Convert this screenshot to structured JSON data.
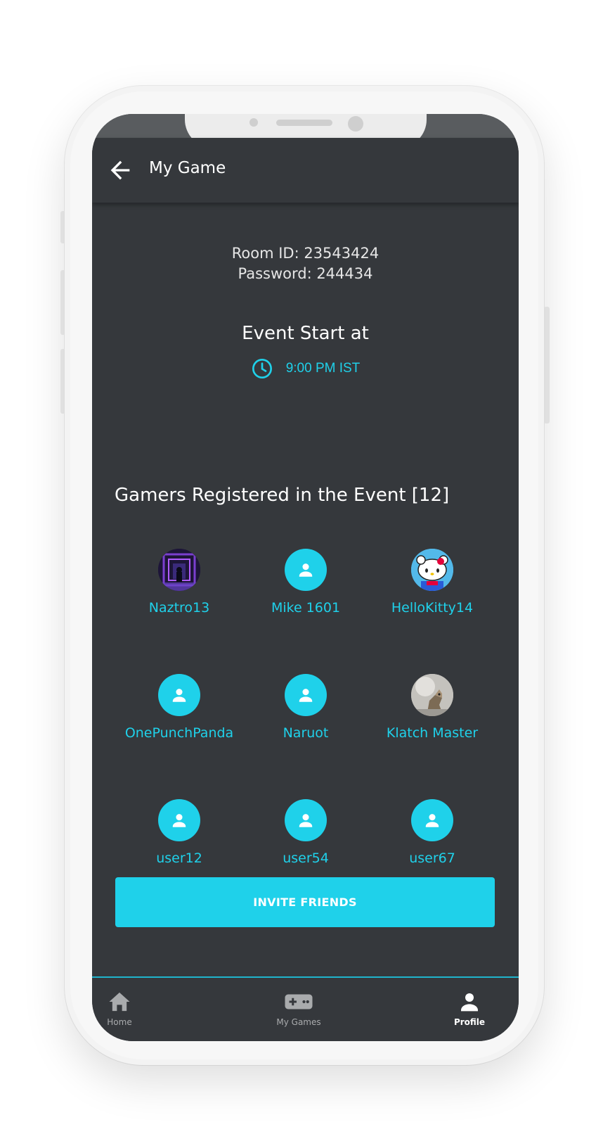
{
  "colors": {
    "accent": "#1fd1ea",
    "background": "#35383c",
    "text": "#ffffff"
  },
  "appbar": {
    "title": "My Game",
    "back_icon": "arrow-left-icon"
  },
  "room": {
    "id_line": "Room ID: 23543424",
    "password_line": "Password: 244434"
  },
  "event": {
    "title": "Event Start at",
    "time": "9:00 PM IST",
    "icon": "clock-icon"
  },
  "gamers": {
    "title": "Gamers Registered in the Event [12]",
    "list": [
      {
        "name": "Naztro13",
        "avatar": "photo"
      },
      {
        "name": "Mike 1601",
        "avatar": "person-icon"
      },
      {
        "name": "HelloKitty14",
        "avatar": "photo"
      },
      {
        "name": "OnePunchPanda",
        "avatar": "person-icon"
      },
      {
        "name": "Naruot",
        "avatar": "person-icon"
      },
      {
        "name": "Klatch Master",
        "avatar": "photo"
      },
      {
        "name": "user12",
        "avatar": "person-icon"
      },
      {
        "name": "user54",
        "avatar": "person-icon"
      },
      {
        "name": "user67",
        "avatar": "person-icon"
      }
    ]
  },
  "invite_button": {
    "label": "INVITE FRIENDS"
  },
  "bottom_nav": {
    "items": [
      {
        "label": "Home",
        "icon": "home-icon"
      },
      {
        "label": "My Games",
        "icon": "gamepad-icon"
      },
      {
        "label": "Profile",
        "icon": "profile-icon",
        "active": true
      }
    ]
  }
}
